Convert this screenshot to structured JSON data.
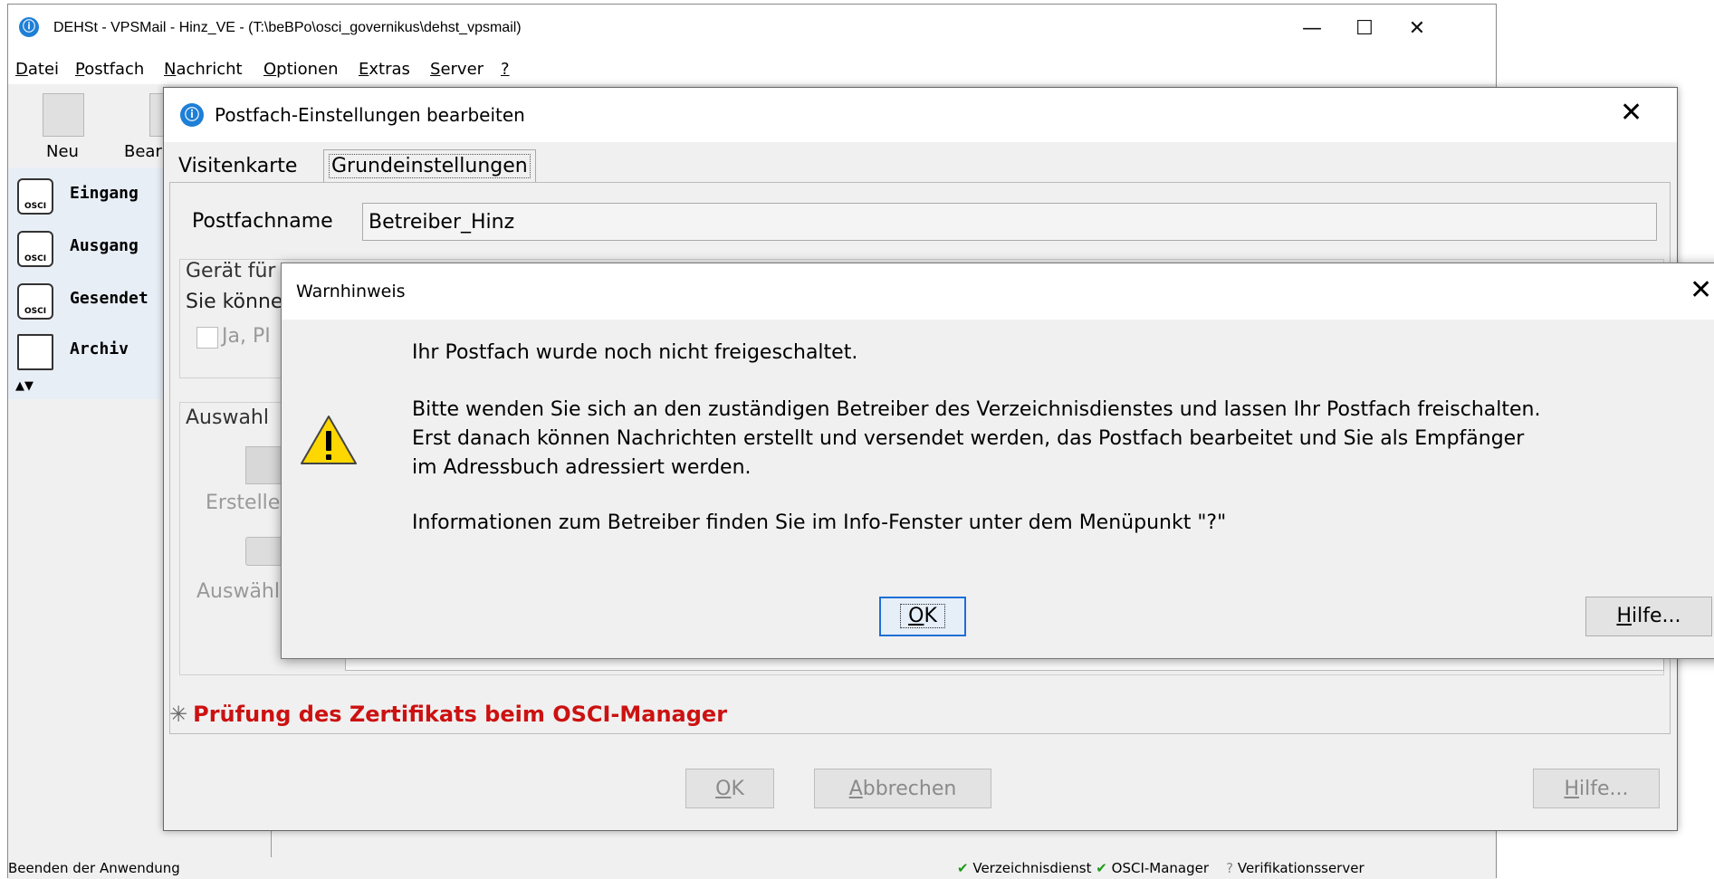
{
  "main_window": {
    "title": "DEHSt - VPSMail - Hinz_VE - (T:\\beBPo\\osci_governikus\\dehst_vpsmail)",
    "controls": {
      "minimize": "—",
      "maximize": "☐",
      "close": "✕"
    },
    "menu": [
      {
        "label": "Datei",
        "mnemonic": "D",
        "rest": "atei"
      },
      {
        "label": "Postfach",
        "mnemonic": "P",
        "rest": "ostfach"
      },
      {
        "label": "Nachricht",
        "mnemonic": "N",
        "rest": "achricht"
      },
      {
        "label": "Optionen",
        "mnemonic": "O",
        "rest": "ptionen"
      },
      {
        "label": "Extras",
        "mnemonic": "E",
        "rest": "xtras"
      },
      {
        "label": "Server",
        "mnemonic": "S",
        "rest": "erver"
      },
      {
        "label": "?",
        "mnemonic": "?",
        "rest": ""
      }
    ],
    "toolbar": {
      "neu": "Neu",
      "bearbeiten": "Bear"
    },
    "sidebar": {
      "items": [
        {
          "label": "Eingang",
          "icon": "osci-inbox-icon"
        },
        {
          "label": "Ausgang",
          "icon": "osci-outbox-icon"
        },
        {
          "label": "Gesendet",
          "icon": "osci-sent-icon"
        },
        {
          "label": "Archiv",
          "icon": "archive-icon"
        }
      ],
      "osci_text": "OSCI",
      "arrows": "▲▼"
    },
    "status": {
      "left": "Beenden der Anwendung",
      "verzeichnisdienst": "Verzeichnisdienst",
      "osci_manager": "OSCI-Manager",
      "verifikationsserver": "Verifikationsserver",
      "check": "✔",
      "unknown": "?"
    }
  },
  "settings_dialog": {
    "title": "Postfach-Einstellungen bearbeiten",
    "close": "✕",
    "tabs": [
      {
        "label": "Visitenkarte"
      },
      {
        "label": "Grundeinstellungen",
        "selected": true
      }
    ],
    "postfachname_label": "Postfachname",
    "postfachname_value": "Betreiber_Hinz",
    "geraet_legend": "Gerät für",
    "geraet_text": "Sie könne",
    "geraet_checkbox_label": "Ja, PI",
    "auswahl_legend": "Auswahl",
    "erstellen_label": "Erstelle",
    "auswaehlen_label": "Auswähl",
    "combo_arrow": "⌵",
    "pruefung_spinner": "✳",
    "pruefung_text": "Prüfung des Zertifikats beim OSCI-Manager",
    "buttons": {
      "ok": {
        "mnemonic": "O",
        "rest": "K"
      },
      "abbrechen": {
        "mnemonic": "A",
        "rest": "bbrechen"
      },
      "hilfe": {
        "mnemonic": "H",
        "rest": "ilfe..."
      }
    }
  },
  "warning_dialog": {
    "title": "Warnhinweis",
    "close": "✕",
    "message_line1": "Ihr Postfach wurde noch nicht freigeschaltet.",
    "message_line2": "Bitte wenden Sie sich an den zuständigen Betreiber des Verzeichnisdienstes und lassen Ihr Postfach freischalten.",
    "message_line3": "Erst danach können Nachrichten erstellt und versendet werden, das Postfach bearbeitet und Sie als Empfänger",
    "message_line4": "im Adressbuch adressiert werden.",
    "message_line5": "Informationen zum Betreiber finden Sie im Info-Fenster unter dem Menüpunkt \"?\"",
    "buttons": {
      "ok": {
        "mnemonic": "O",
        "rest": "K"
      },
      "hilfe": {
        "mnemonic": "H",
        "rest": "ilfe..."
      }
    },
    "icon": "warning-icon",
    "accent_color": "#1f6fd6",
    "warning_color": "#ffd700"
  }
}
